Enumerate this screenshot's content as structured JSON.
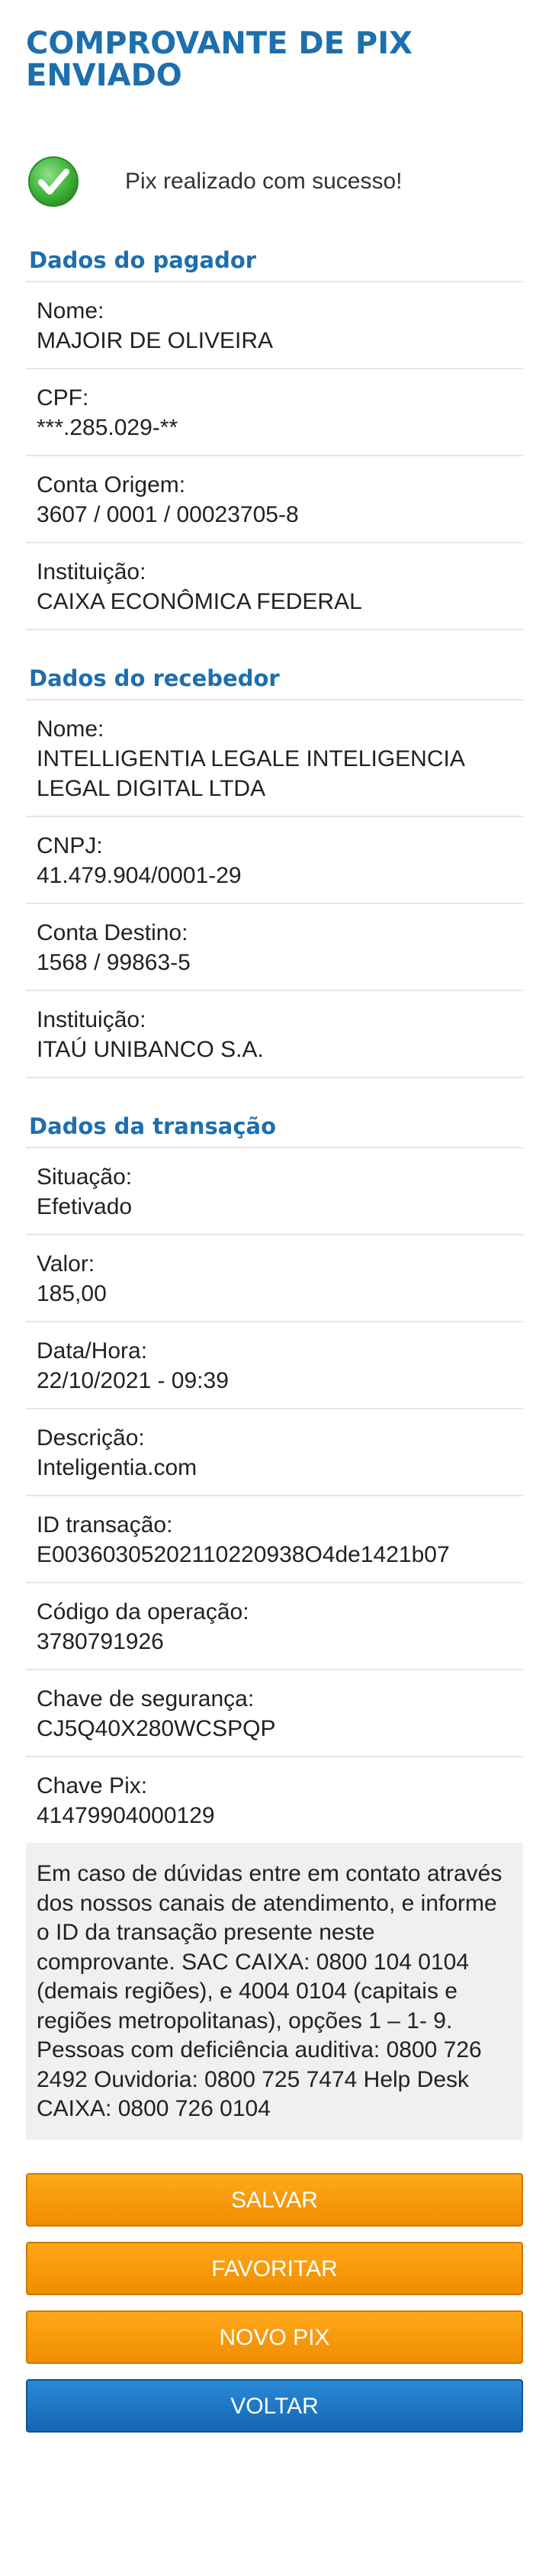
{
  "header": {
    "title": "COMPROVANTE DE PIX ENVIADO"
  },
  "status": {
    "icon": "check-icon",
    "message": "Pix realizado com sucesso!",
    "color": "#4bb543"
  },
  "pagador": {
    "section_title": "Dados do pagador",
    "fields": [
      {
        "label": "Nome:",
        "value": "MAJOIR DE OLIVEIRA"
      },
      {
        "label": "CPF:",
        "value": "***.285.029-**"
      },
      {
        "label": "Conta Origem:",
        "value": "3607 / 0001 / 00023705-8"
      },
      {
        "label": "Instituição:",
        "value": "CAIXA ECONÔMICA FEDERAL"
      }
    ]
  },
  "recebedor": {
    "section_title": "Dados do recebedor",
    "fields": [
      {
        "label": "Nome:",
        "value": "INTELLIGENTIA LEGALE INTELIGENCIA LEGAL DIGITAL LTDA"
      },
      {
        "label": "CNPJ:",
        "value": "41.479.904/0001-29"
      },
      {
        "label": "Conta Destino:",
        "value": "1568 / 99863-5"
      },
      {
        "label": "Instituição:",
        "value": "ITAÚ UNIBANCO S.A."
      }
    ]
  },
  "transacao": {
    "section_title": "Dados da transação",
    "fields": [
      {
        "label": "Situação:",
        "value": "Efetivado"
      },
      {
        "label": "Valor:",
        "value": "185,00"
      },
      {
        "label": "Data/Hora:",
        "value": "22/10/2021 - 09:39"
      },
      {
        "label": "Descrição:",
        "value": "Inteligentia.com"
      },
      {
        "label": "ID transação:",
        "value": "E00360305202110220938O4de1421b07"
      },
      {
        "label": "Código da operação:",
        "value": "3780791926"
      },
      {
        "label": "Chave de segurança:",
        "value": "CJ5Q40X280WCSPQP"
      },
      {
        "label": "Chave Pix:",
        "value": "41479904000129"
      }
    ]
  },
  "notice": {
    "text": "Em caso de dúvidas entre em contato através dos nossos canais de atendimento, e informe o ID da transação presente neste comprovante. SAC CAIXA: 0800 104 0104 (demais regiões), e 4004 0104 (capitais e regiões metropolitanas), opções 1 – 1- 9. Pessoas com deficiência auditiva: 0800 726 2492 Ouvidoria: 0800 725 7474 Help Desk CAIXA: 0800 726 0104"
  },
  "buttons": {
    "salvar": "SALVAR",
    "favoritar": "FAVORITAR",
    "novo_pix": "NOVO PIX",
    "voltar": "VOLTAR"
  },
  "colors": {
    "heading": "#1d6fad",
    "button_orange": "#f59a0a",
    "button_blue": "#1a74c4"
  }
}
